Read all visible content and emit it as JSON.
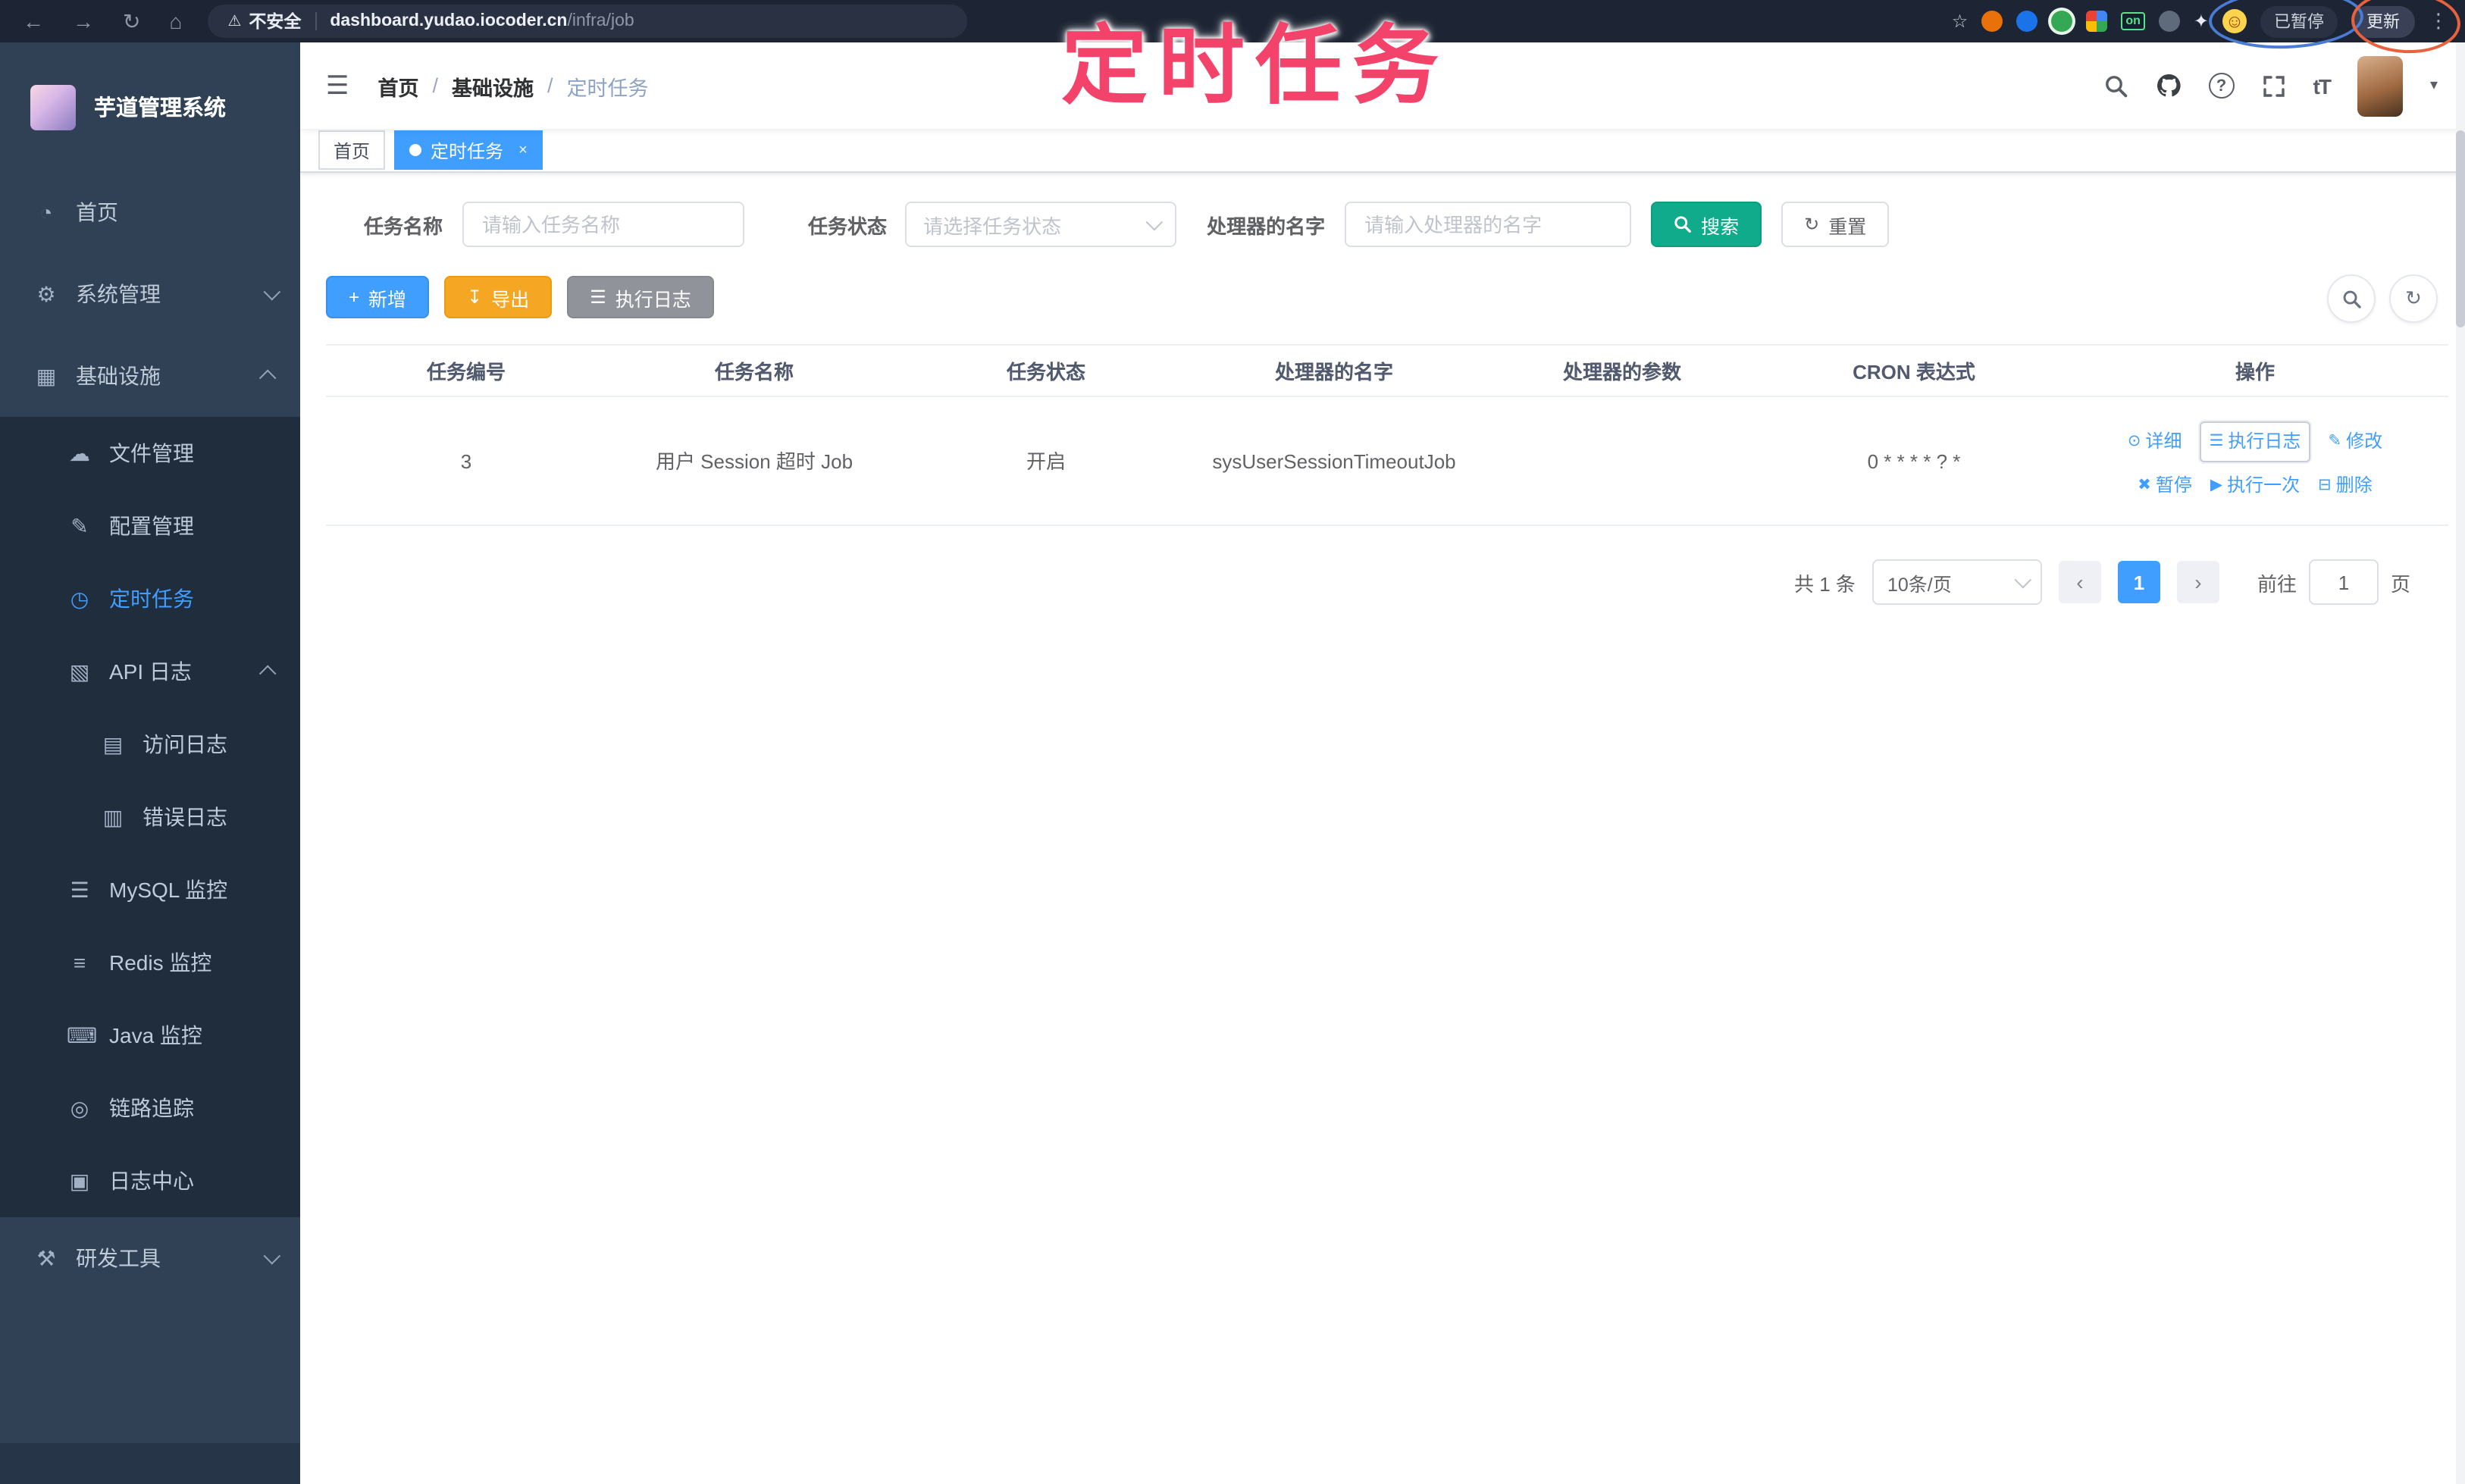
{
  "browser": {
    "security_label": "不安全",
    "url_host": "dashboard.yudao.iocoder.cn",
    "url_path": "/infra/job",
    "paused_label": "已暂停",
    "update_label": "更新",
    "on_badge": "on"
  },
  "annotation": {
    "title": "定时任务"
  },
  "icons": {
    "back": "←",
    "forward": "→",
    "reload": "↻",
    "home": "⌂",
    "warning": "⚠",
    "star": "☆",
    "puzzle": "✦",
    "emoji": "☺",
    "kebab": "⋮",
    "hamburger": "☰",
    "caret_down": "▾",
    "fontsize": "tT",
    "help": "?",
    "dashboard": "◔",
    "system": "⚙",
    "infra": "▦",
    "file": "☁",
    "config": "✎",
    "job": "◷",
    "apilog": "▧",
    "accesslog": "▤",
    "errorlog": "▥",
    "mysql": "☰",
    "redis": "≡",
    "java": "⌨",
    "trace": "◎",
    "logcenter": "▣",
    "devtools": "⚒",
    "plus": "+",
    "download": "↧",
    "loglist": "☰",
    "reset": "↻",
    "refresh": "↻",
    "eye": "⊙",
    "oplog": "☰",
    "edit": "✎",
    "pause": "✖",
    "play": "▶",
    "trash": "⊟",
    "prev": "‹",
    "next": "›"
  },
  "sidebar": {
    "app_title": "芋道管理系统",
    "items": [
      {
        "label": "首页"
      },
      {
        "label": "系统管理"
      },
      {
        "label": "基础设施"
      },
      {
        "label": "文件管理"
      },
      {
        "label": "配置管理"
      },
      {
        "label": "定时任务"
      },
      {
        "label": "API 日志"
      },
      {
        "label": "访问日志"
      },
      {
        "label": "错误日志"
      },
      {
        "label": "MySQL 监控"
      },
      {
        "label": "Redis 监控"
      },
      {
        "label": "Java 监控"
      },
      {
        "label": "链路追踪"
      },
      {
        "label": "日志中心"
      },
      {
        "label": "研发工具"
      }
    ]
  },
  "header": {
    "breadcrumb": [
      "首页",
      "基础设施",
      "定时任务"
    ],
    "sep": "/"
  },
  "tabs": [
    {
      "label": "首页"
    },
    {
      "label": "定时任务"
    }
  ],
  "filters": {
    "name_label": "任务名称",
    "name_placeholder": "请输入任务名称",
    "status_label": "任务状态",
    "status_placeholder": "请选择任务状态",
    "handler_label": "处理器的名字",
    "handler_placeholder": "请输入处理器的名字",
    "search_label": "搜索",
    "reset_label": "重置"
  },
  "toolbar": {
    "add": "新增",
    "export": "导出",
    "exec_log": "执行日志"
  },
  "table": {
    "headers": [
      "任务编号",
      "任务名称",
      "任务状态",
      "处理器的名字",
      "处理器的参数",
      "CRON 表达式",
      "操作"
    ],
    "rows": [
      {
        "id": "3",
        "name": "用户 Session 超时 Job",
        "status": "开启",
        "handler": "sysUserSessionTimeoutJob",
        "param": "",
        "cron": "0 * * * * ? *"
      }
    ],
    "ops1": [
      "详细",
      "执行日志",
      "修改"
    ],
    "ops2": [
      "暂停",
      "执行一次",
      "删除"
    ]
  },
  "pagination": {
    "total": "共 1 条",
    "page_size": "10条/页",
    "page": "1",
    "goto_label": "前往",
    "goto_value": "1",
    "unit": "页"
  },
  "colors": {
    "accent_blue": "#409EFF",
    "search_teal": "#10ab8a",
    "export_yellow": "#f5a623",
    "info_gray": "#909399",
    "sidebar_bg": "#304156",
    "submenu_bg": "#1f2d3d",
    "browser_bg": "#1d2433",
    "annotation_pink": "#f4436a"
  }
}
